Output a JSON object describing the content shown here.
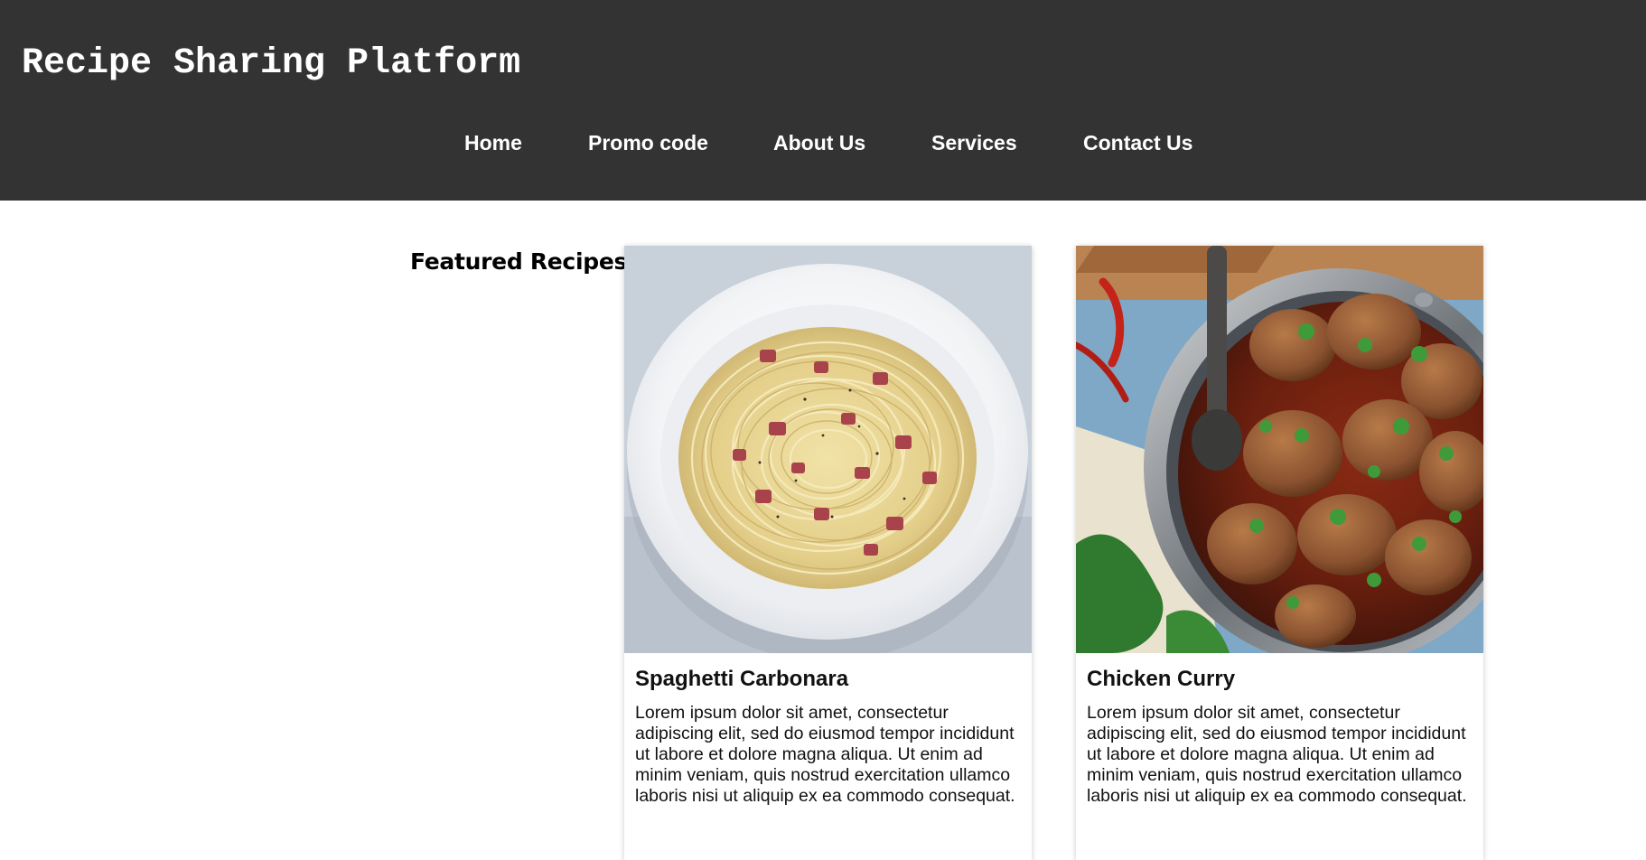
{
  "header": {
    "title": "Recipe Sharing Platform",
    "background_color": "#333333"
  },
  "nav": {
    "items": [
      {
        "label": "Home"
      },
      {
        "label": "Promo code"
      },
      {
        "label": "About Us"
      },
      {
        "label": "Services"
      },
      {
        "label": "Contact Us"
      }
    ]
  },
  "main": {
    "section_heading": "Featured Recipes",
    "cards": [
      {
        "title": "Spaghetti Carbonara",
        "image": "spaghetti-carbonara-photo",
        "description": "Lorem ipsum dolor sit amet, consectetur adipiscing elit, sed do eiusmod tempor incididunt ut labore et dolore magna aliqua. Ut enim ad minim veniam, quis nostrud exercitation ullamco laboris nisi ut aliquip ex ea commodo consequat."
      },
      {
        "title": "Chicken Curry",
        "image": "chicken-curry-photo",
        "description": "Lorem ipsum dolor sit amet, consectetur adipiscing elit, sed do eiusmod tempor incididunt ut labore et dolore magna aliqua. Ut enim ad minim veniam, quis nostrud exercitation ullamco laboris nisi ut aliquip ex ea commodo consequat."
      }
    ]
  }
}
